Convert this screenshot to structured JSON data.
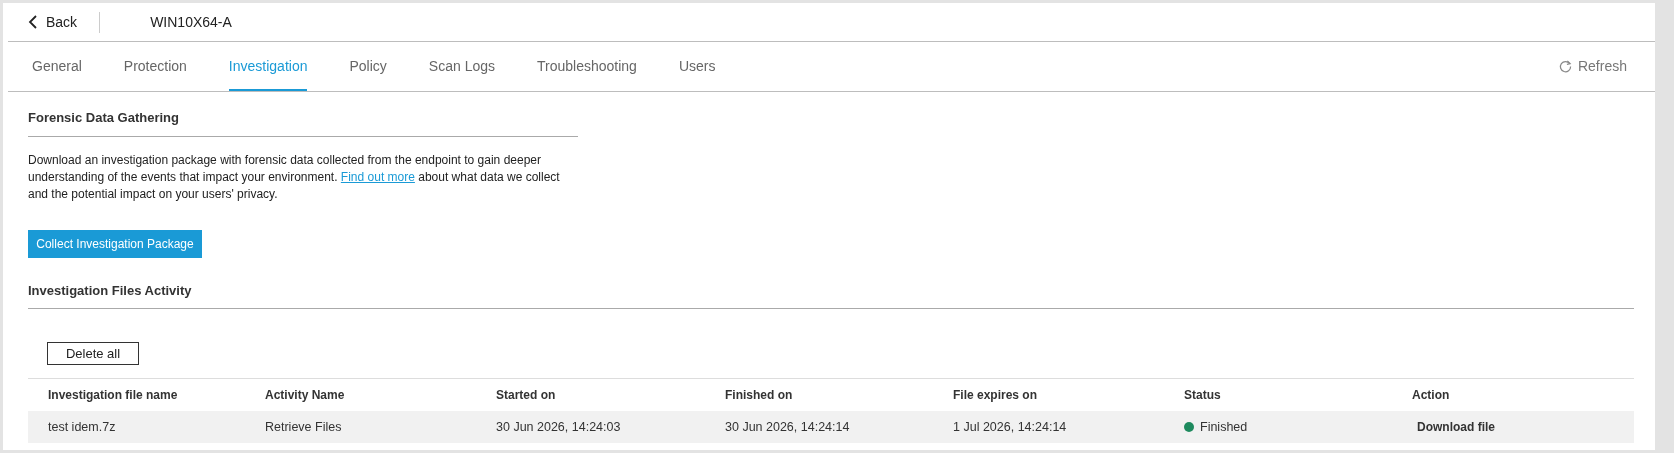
{
  "header": {
    "back": "Back",
    "device": "WIN10X64-A"
  },
  "tabs": [
    {
      "label": "General",
      "selected": false
    },
    {
      "label": "Protection",
      "selected": false
    },
    {
      "label": "Investigation",
      "selected": true
    },
    {
      "label": "Policy",
      "selected": false
    },
    {
      "label": "Scan Logs",
      "selected": false
    },
    {
      "label": "Troubleshooting",
      "selected": false
    },
    {
      "label": "Users",
      "selected": false
    }
  ],
  "refresh": "Refresh",
  "forensic": {
    "title": "Forensic Data Gathering",
    "text_before": "Download an investigation package with forensic data collected from the endpoint to gain deeper understanding of the events that impact your environment.",
    "link": "Find out more",
    "text_after": "about what data we collect and the potential impact on your users' privacy.",
    "button": "Collect Investigation Package"
  },
  "activity": {
    "title": "Investigation Files Activity",
    "delete_button": "Delete all",
    "columns": [
      "Investigation file name",
      "Activity Name",
      "Started on",
      "Finished on",
      "File expires on",
      "Status",
      "Action"
    ],
    "rows": [
      {
        "file": "test idem.7z",
        "activity": "Retrieve Files",
        "started": "30 Jun 2026, 14:24:03",
        "finished": "30 Jun 2026, 14:24:14",
        "expires": "1 Jul 2026, 14:24:14",
        "status": "Finished",
        "color": "#1e8a5e",
        "action": "Download file"
      }
    ]
  }
}
